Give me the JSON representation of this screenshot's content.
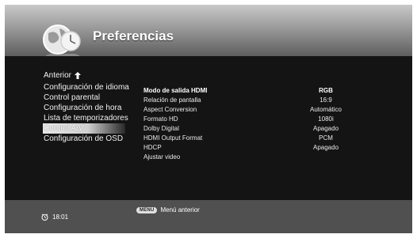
{
  "header": {
    "title": "Preferencias",
    "logo_icon": "globe-clock-icon"
  },
  "menu": {
    "back_label": "Anterior",
    "items": [
      {
        "label": "Configuración de idioma",
        "selected": false
      },
      {
        "label": "Control parental",
        "selected": false
      },
      {
        "label": "Configuración de hora",
        "selected": false
      },
      {
        "label": "Lista de temporizadores",
        "selected": false
      },
      {
        "label": "Control A/V",
        "selected": true
      },
      {
        "label": "Configuración de OSD",
        "selected": false
      }
    ]
  },
  "settings": [
    {
      "label": "Modo de salida HDMI",
      "value": "RGB",
      "active": true
    },
    {
      "label": "Relación de pantalla",
      "value": "16:9",
      "active": false
    },
    {
      "label": "Aspect Conversion",
      "value": "Automático",
      "active": false
    },
    {
      "label": "Formato HD",
      "value": "1080i",
      "active": false
    },
    {
      "label": "Dolby Digital",
      "value": "Apagado",
      "active": false
    },
    {
      "label": "HDMI Output Format",
      "value": "PCM",
      "active": false
    },
    {
      "label": "HDCP",
      "value": "Apagado",
      "active": false
    },
    {
      "label": "Ajustar video",
      "value": "",
      "active": false
    }
  ],
  "footer": {
    "time": "18:01",
    "menu_key": "MENU",
    "menu_hint": "Menú anterior"
  },
  "colors": {
    "background": "#141414",
    "footer": "#505050",
    "text": "#ffffff"
  }
}
